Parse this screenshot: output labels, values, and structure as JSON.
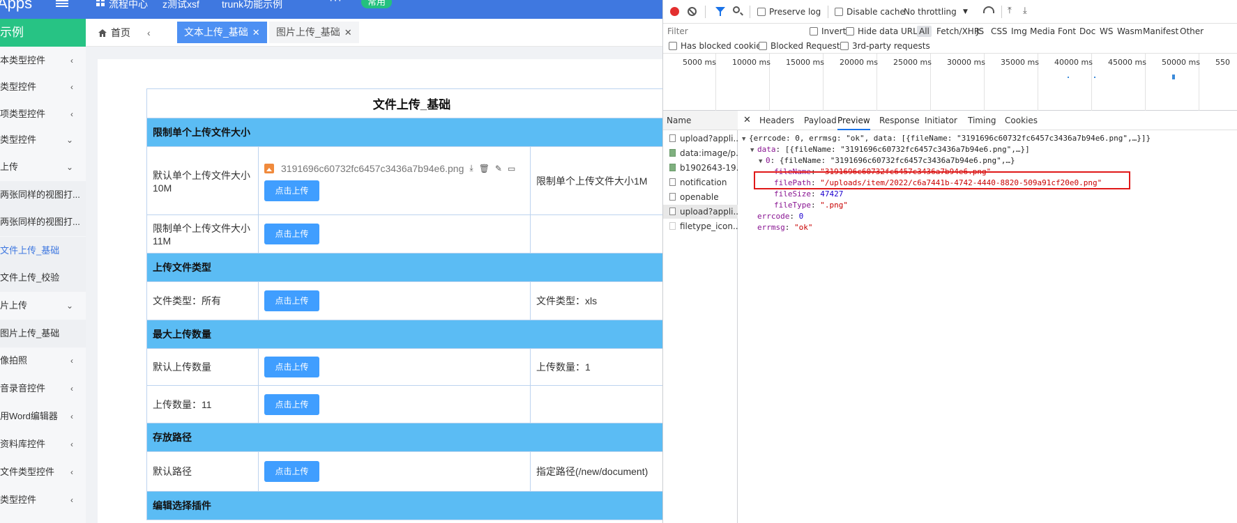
{
  "app": {
    "brand": "Apps",
    "nav": [
      "流程中心",
      "z测试xsf",
      "trunk功能示例"
    ],
    "more": "···",
    "common_badge": "常用",
    "side_header": "示例",
    "sidebar": [
      {
        "label": "本类型控件",
        "arrow": "‹"
      },
      {
        "label": "类型控件",
        "arrow": "‹"
      },
      {
        "label": "项类型控件",
        "arrow": "‹"
      },
      {
        "label": "类型控件",
        "arrow": "⌄"
      },
      {
        "label": "上传",
        "arrow": "⌄"
      },
      {
        "label": "两张同样的视图打...",
        "arrow": ""
      },
      {
        "label": "两张同样的视图打...",
        "arrow": ""
      },
      {
        "label": "文件上传_基础",
        "arrow": ""
      },
      {
        "label": "文件上传_校验",
        "arrow": ""
      },
      {
        "label": "片上传",
        "arrow": "⌄"
      },
      {
        "label": "图片上传_基础",
        "arrow": ""
      },
      {
        "label": "像拍照",
        "arrow": "‹"
      },
      {
        "label": "音录音控件",
        "arrow": "‹"
      },
      {
        "label": "用Word编辑器",
        "arrow": "‹"
      },
      {
        "label": "资料库控件",
        "arrow": "‹"
      },
      {
        "label": "文件类型控件",
        "arrow": "‹"
      },
      {
        "label": "类型控件",
        "arrow": "‹"
      }
    ],
    "tabs": {
      "home": "首页",
      "prev": "‹",
      "active": "文本上传_基础",
      "inactive": "图片上传_基础",
      "close": "✕"
    },
    "form": {
      "title": "文件上传_基础",
      "upload_btn": "点击上传",
      "sections": {
        "s1": "限制单个上传文件大小",
        "s2": "上传文件类型",
        "s3": "最大上传数量",
        "s4": "存放路径",
        "s5": "编辑选择插件"
      },
      "rows": {
        "r1_left": "默认单个上传文件大小10M",
        "r1_file": "3191696c60732fc6457c3436a7b94e6.png",
        "r1_right": "限制单个上传文件大小1M",
        "r2_left": "限制单个上传文件大小11M",
        "r3_left": "文件类型：所有",
        "r3_right": "文件类型：xls",
        "r4_left": "默认上传数量",
        "r4_right": "上传数量：1",
        "r5_left": "上传数量：11",
        "r6_left": "默认路径",
        "r6_right": "指定路径(/new/document)"
      },
      "file_actions": [
        "⤓",
        "🗑",
        "✎",
        "▭"
      ]
    }
  },
  "devtools": {
    "toolbar": {
      "preserve_log": "Preserve log",
      "disable_cache": "Disable cache",
      "throttling": "No throttling",
      "dropdown": "▼",
      "upload": "⤒",
      "download": "⤓"
    },
    "filter": {
      "placeholder": "Filter",
      "invert": "Invert",
      "hide_data_urls": "Hide data URLs",
      "types": [
        "All",
        "Fetch/XHR",
        "JS",
        "CSS",
        "Img",
        "Media",
        "Font",
        "Doc",
        "WS",
        "Wasm",
        "Manifest",
        "Other"
      ]
    },
    "row3": {
      "blocked_cookies": "Has blocked cookies",
      "blocked_requests": "Blocked Requests",
      "third_party": "3rd-party requests"
    },
    "timeline_ticks": [
      "5000 ms",
      "10000 ms",
      "15000 ms",
      "20000 ms",
      "25000 ms",
      "30000 ms",
      "35000 ms",
      "40000 ms",
      "45000 ms",
      "50000 ms",
      "550"
    ],
    "name_header": "Name",
    "requests": [
      {
        "name": "upload?appli...",
        "icon": "doc"
      },
      {
        "name": "data:image/p...",
        "icon": "img"
      },
      {
        "name": "b1902643-19...",
        "icon": "img"
      },
      {
        "name": "notification",
        "icon": "doc"
      },
      {
        "name": "openable",
        "icon": "doc"
      },
      {
        "name": "upload?appli...",
        "icon": "doc"
      },
      {
        "name": "filetype_icon....",
        "icon": "faint"
      }
    ],
    "detail_close": "✕",
    "detail_tabs": [
      "Headers",
      "Payload",
      "Preview",
      "Response",
      "Initiator",
      "Timing",
      "Cookies"
    ],
    "preview": {
      "l1": "{errcode: 0, errmsg: \"ok\", data: [{fileName: \"3191696c60732fc6457c3436a7b94e6.png\",…}]}",
      "l2_key": "data",
      "l2_val": "[{fileName: \"3191696c60732fc6457c3436a7b94e6.png\",…}]",
      "l3_key": "0",
      "l3_val": "{fileName: \"3191696c60732fc6457c3436a7b94e6.png\",…}",
      "fileName_key": "fileName",
      "fileName_val": "\"3191696c60732fc6457c3436a7b94e6.png\"",
      "filePath_key": "filePath",
      "filePath_val": "\"/uploads/item/2022/c6a7441b-4742-4440-8820-509a91cf20e0.png\"",
      "fileSize_key": "fileSize",
      "fileSize_val": "47427",
      "fileType_key": "fileType",
      "fileType_val": "\".png\"",
      "errcode_key": "errcode",
      "errcode_val": "0",
      "errmsg_key": "errmsg",
      "errmsg_val": "\"ok\""
    }
  }
}
